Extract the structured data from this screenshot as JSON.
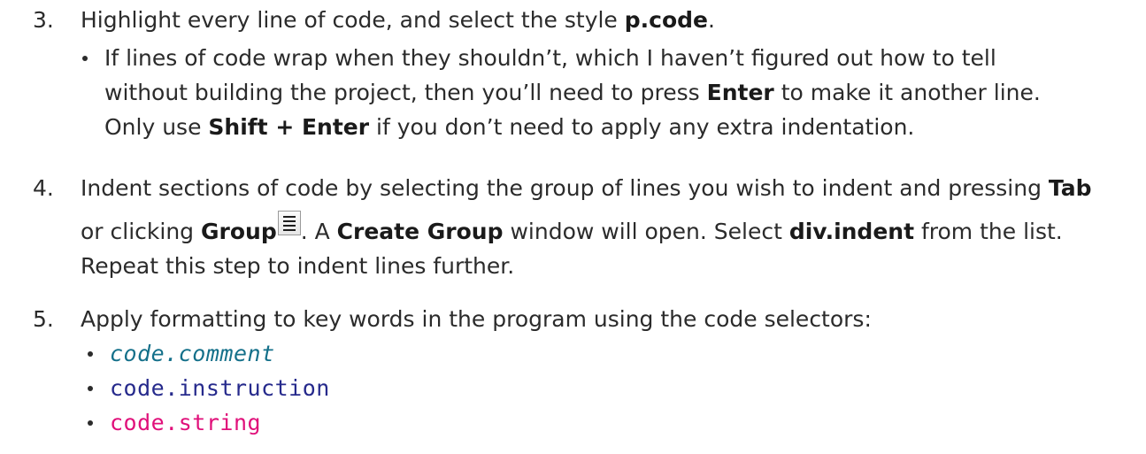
{
  "steps": [
    {
      "number": "3.",
      "line1_pre": "Highlight every line of code, and select the style ",
      "line1_bold": "p.code",
      "line1_post": ".",
      "sub_line1": "If lines of code wrap when they shouldn’t, which I haven’t figured out how to tell",
      "sub_line2_pre": "without building the project, then you’ll need to press ",
      "sub_line2_bold": "Enter",
      "sub_line2_post": " to make it another line.",
      "sub_line3_pre": "Only use ",
      "sub_line3_bold": "Shift + Enter",
      "sub_line3_post": " if you don’t need to apply any extra indentation."
    },
    {
      "number": "4.",
      "line1_pre": "Indent sections of code by selecting the group of lines you wish to indent and pressing ",
      "line1_bold": "Tab",
      "line2_pre": "or clicking ",
      "line2_bold": "Group",
      "line2_mid": ". A ",
      "line2_bold2": "Create Group",
      "line2_mid2": " window will open. Select ",
      "line2_bold3": "div.indent",
      "line2_post": " from the list.",
      "line3": "Repeat this step to indent lines further.",
      "icon": "group-icon"
    },
    {
      "number": "5.",
      "line1": "Apply formatting to key words in the program using the code selectors:",
      "selectors": [
        {
          "label": "code.comment",
          "color": "#14708a",
          "italic": true
        },
        {
          "label": "code.instruction",
          "color": "#262a8c",
          "italic": false
        },
        {
          "label": "code.string",
          "color": "#e0107a",
          "italic": false
        }
      ]
    }
  ]
}
